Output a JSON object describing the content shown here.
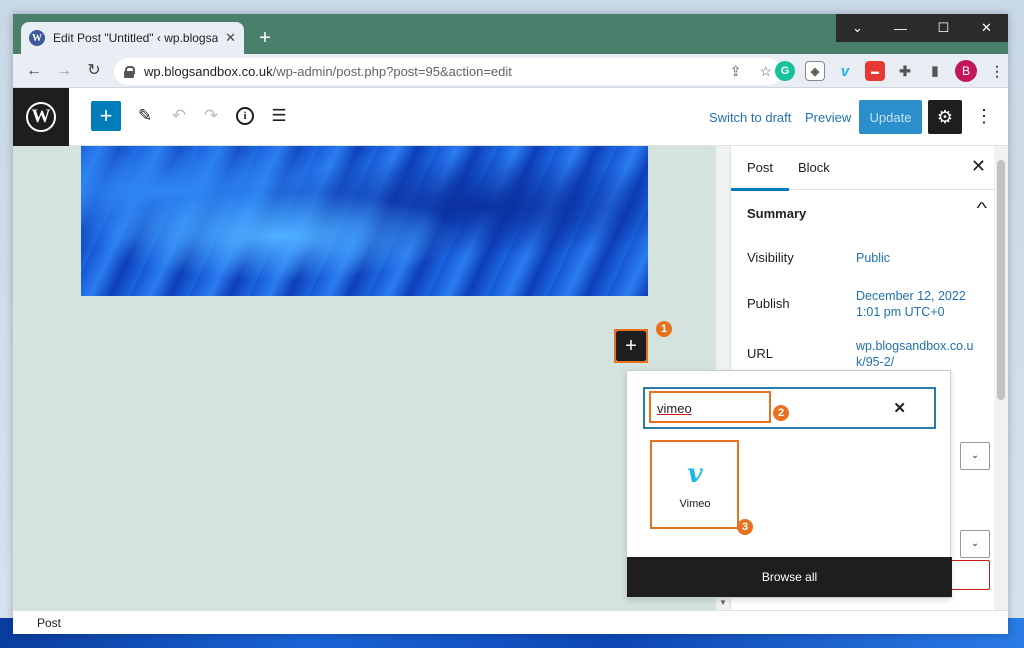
{
  "browser": {
    "tab_title": "Edit Post \"Untitled\" ‹ wp.blogsandbox",
    "tab_close": "✕",
    "new_tab": "+",
    "url_domain": "wp.blogsandbox.co.uk",
    "url_path": "/wp-admin/post.php?post=95&action=edit",
    "profile_initial": "B"
  },
  "header": {
    "switch_to_draft": "Switch to draft",
    "preview": "Preview",
    "update": "Update"
  },
  "sidebar": {
    "tab_post": "Post",
    "tab_block": "Block",
    "summary_title": "Summary",
    "rows": [
      {
        "label": "Visibility",
        "value": "Public"
      },
      {
        "label": "Publish",
        "value": "December 12, 2022 1:01 pm UTC+0"
      },
      {
        "label": "URL",
        "value": "wp.blogsandbox.co.uk/95-2/"
      }
    ]
  },
  "inserter": {
    "search_value": "vimeo",
    "result_label": "Vimeo",
    "browse_all": "Browse all"
  },
  "callouts": [
    "1",
    "2",
    "3"
  ],
  "footer": {
    "breadcrumb": "Post"
  },
  "colors": {
    "wp_blue": "#007cba",
    "callout_orange": "#e8711f",
    "vimeo_blue": "#1ab7ea",
    "canvas_bg": "#d4e3dd"
  }
}
